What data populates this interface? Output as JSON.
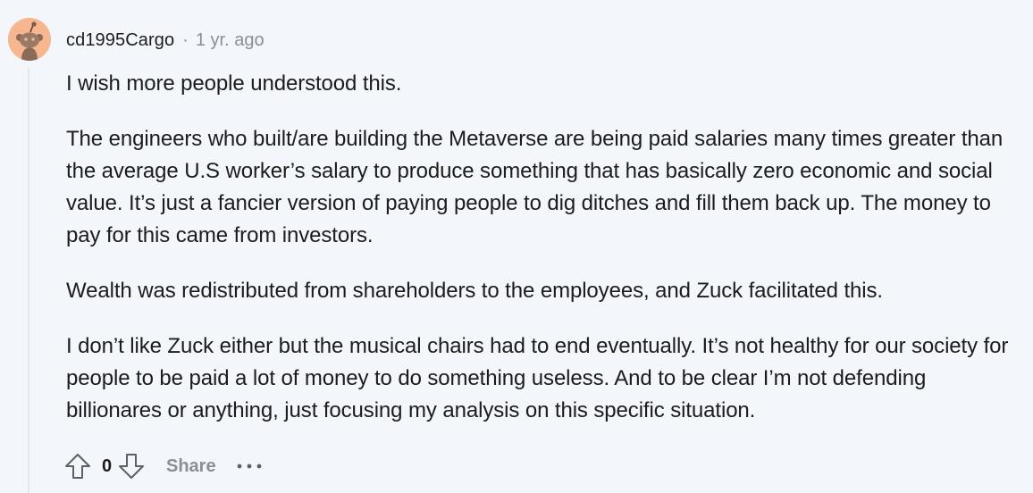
{
  "comment": {
    "author": "cd1995Cargo",
    "separator": "·",
    "timestamp": "1 yr. ago",
    "avatar_icon": "snoo-avatar-icon",
    "avatar_color": "#f5b58a",
    "paragraphs": [
      "I wish more people understood this.",
      "The engineers who built/are building the Metaverse are being paid salaries many times greater than the average U.S worker’s salary to produce something that has basically zero economic and social value. It’s just a fancier version of paying people to dig ditches and fill them back up. The money to pay for this came from investors.",
      "Wealth was redistributed from shareholders to the employees, and Zuck facilitated this.",
      "I don’t like Zuck either but the musical chairs had to end eventually. It’s not healthy for our society for people to be paid a lot of money to do something useless. And to be clear I’m not defending billionares or anything, just focusing my analysis on this specific situation."
    ]
  },
  "actions": {
    "upvote_icon": "arrow-up-icon",
    "vote_count": "0",
    "downvote_icon": "arrow-down-icon",
    "share_label": "Share",
    "more_icon": "more-options-icon"
  }
}
